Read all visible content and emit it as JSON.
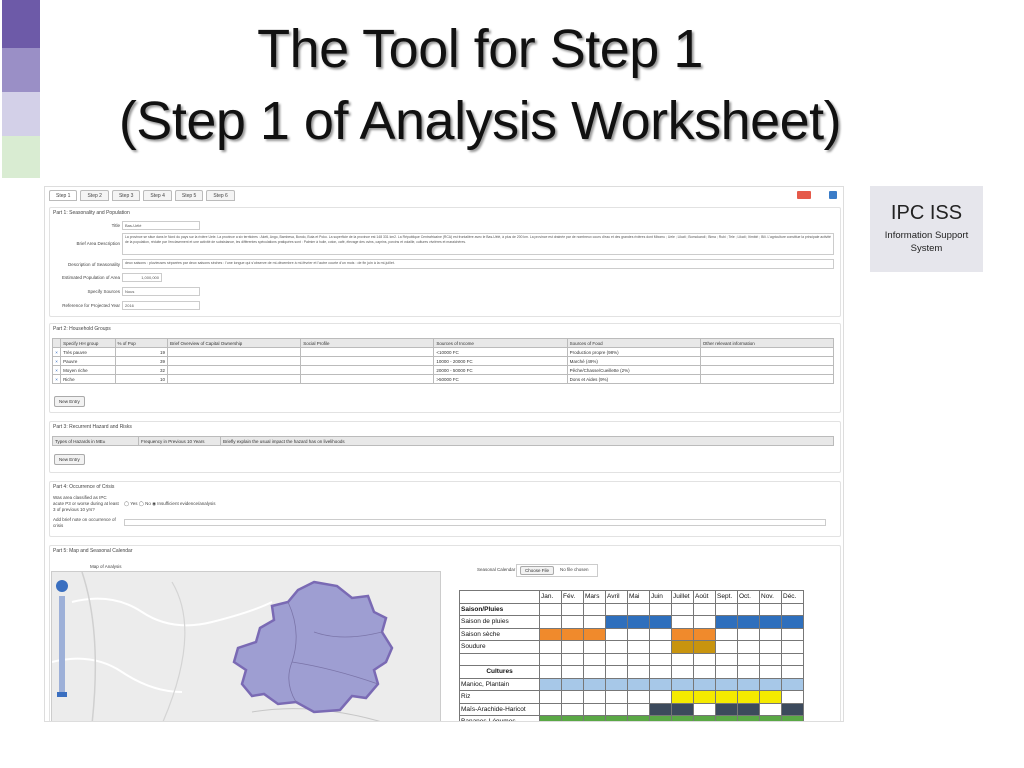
{
  "title_line1": "The Tool for Step 1",
  "title_line2": "(Step 1 of Analysis Worksheet)",
  "ipc": {
    "title": "IPC ISS",
    "line1": "Information Support",
    "line2": "System"
  },
  "tabs": [
    "Step 1",
    "Step 2",
    "Step 3",
    "Step 4",
    "Step 5",
    "Step 6"
  ],
  "part1": {
    "label": "Part 1: Seasonality and Population",
    "title_label": "Title",
    "title_value": "Bas-Uélé",
    "brief_label": "Brief Area Description",
    "brief_value": "La province se situe dans le Nord du pays sur la rivière Uele. La province a six territoires : Aketi, Ango, Bambesa, Bondo, Buta et Poko. La superficie de la province est 148 331 km2. La République Centrafricaine (RCA) est frontalière avec le Bas-Uélé, à plus de 200 km. La province est drainée par de nombreux cours d'eau et des grandes rivières dont Mbomu ; Uele ; Likati ; Bomokandi ; Bima ; Rubi ; Tele ; Likati ; Itimbiri ; Bili. L'agriculture constitue la principale activité de la population, réduite par l'enclavement et une activité de subsistance, les différentes spéculations pratiquées sont : Palmier à huile, coton, café, élevage des ovins, caprins, porcins et volaille, cultures vivrières et maraichères.",
    "season_label": "Description of Seasonality",
    "season_value": "deux saisons : pluvieuses séparées par deux saisons sèches : l'une longue qui s'observe de mi-décembre à mi-février et l'autre courte d'un mois : de fin juin à la mi-juillet.",
    "pop_label": "Estimated Population of Area",
    "pop_value": "1,000,000",
    "sources_label": "Specify Sources",
    "sources_value": "Nous",
    "ref_label": "Reference for Projected Year",
    "ref_value": "2016"
  },
  "part2": {
    "label": "Part 2: Household Groups",
    "headers": [
      "Specify HH group",
      "% of Pop",
      "Brief Overview of Capital Ownership",
      "Social Profile",
      "Sources of Income",
      "Sources of Food",
      "Other relevant information"
    ],
    "rows": [
      {
        "mark": "×",
        "group": "Très pauvre",
        "pct": "19",
        "income": "<10000 FC",
        "food": "Production propre (98%)"
      },
      {
        "mark": "×",
        "group": "Pauvre",
        "pct": "39",
        "income": "10000 - 20000 FC",
        "food": "Marché (49%)"
      },
      {
        "mark": "×",
        "group": "Moyen riche",
        "pct": "32",
        "income": "20000 - 50000 FC",
        "food": "Pêche/Chasse/Cueillette (2%)"
      },
      {
        "mark": "×",
        "group": "Riche",
        "pct": "10",
        "income": ">50000 FC",
        "food": "Dons et Aides (9%)"
      }
    ],
    "new_entry": "New Entry"
  },
  "part3": {
    "label": "Part 3: Recurrent Hazard and Risks",
    "headers": [
      "Types of Hazards in ΜΕ±",
      "Frequency in Previous 10 Years",
      "Briefly explain the usual impact the hazard has on livelihoods"
    ],
    "new_entry": "New Entry"
  },
  "part4": {
    "label": "Part 4: Occurrence of Crisis",
    "q1_l1": "Was area classified as IPC",
    "q1_l2": "acute P3 or worse during at least",
    "q1_l3": "3 of previous 10 yrs?",
    "options": "◯ Yes   ◯ No   ◉ Insufficient evidence/analysis",
    "q2_l1": "Add brief note on occurrence of",
    "q2_l2": "crisis"
  },
  "part5": {
    "label": "Part 5: Map and Seasonal Calendar",
    "map_label": "Map of Analysis",
    "cal_label": "Seasonal Calendar",
    "choose_file": "Choose File",
    "no_file": "No file chosen"
  },
  "calendar": {
    "months": [
      "Jan.",
      "Fév.",
      "Mars",
      "Avril",
      "Mai",
      "Juin",
      "Juillet",
      "Août",
      "Sept.",
      "Oct.",
      "Nov.",
      "Déc."
    ],
    "rows": [
      {
        "label": "Saison/Pluies",
        "bold": true,
        "cells": [
          "",
          "",
          "",
          "",
          "",
          "",
          "",
          "",
          "",
          "",
          "",
          ""
        ]
      },
      {
        "label": "Saison de pluies",
        "cells": [
          "",
          "",
          "",
          "#2e6fbd",
          "#2e6fbd",
          "#2e6fbd",
          "",
          "",
          "#2e6fbd",
          "#2e6fbd",
          "#2e6fbd",
          "#2e6fbd"
        ]
      },
      {
        "label": "Saison sèche",
        "cells": [
          "#f08a2c",
          "#f08a2c",
          "#f08a2c",
          "",
          "",
          "",
          "#f08a2c",
          "#f08a2c",
          "",
          "",
          "",
          ""
        ]
      },
      {
        "label": "Soudure",
        "cells": [
          "",
          "",
          "",
          "",
          "",
          "",
          "#c8940e",
          "#c8940e",
          "",
          "",
          "",
          ""
        ]
      },
      {
        "label": "",
        "cells": [
          "",
          "",
          "",
          "",
          "",
          "",
          "",
          "",
          "",
          "",
          "",
          ""
        ]
      },
      {
        "label": "Cultures",
        "bold": true,
        "center": true,
        "cells": [
          "",
          "",
          "",
          "",
          "",
          "",
          "",
          "",
          "",
          "",
          "",
          ""
        ]
      },
      {
        "label": "Manioc, Plantain",
        "cells": [
          "#a7c8e8",
          "#a7c8e8",
          "#a7c8e8",
          "#a7c8e8",
          "#a7c8e8",
          "#a7c8e8",
          "#a7c8e8",
          "#a7c8e8",
          "#a7c8e8",
          "#a7c8e8",
          "#a7c8e8",
          "#a7c8e8"
        ]
      },
      {
        "label": "Riz",
        "cells": [
          "",
          "",
          "",
          "",
          "",
          "",
          "#f5ea00",
          "#f5ea00",
          "#f5ea00",
          "#f5ea00",
          "#f5ea00",
          ""
        ]
      },
      {
        "label": "Maïs-Arachide-Haricot",
        "cells": [
          "",
          "",
          "",
          "",
          "",
          "#3c4a5c",
          "#3c4a5c",
          "",
          "#3c4a5c",
          "#3c4a5c",
          "",
          "#3c4a5c"
        ]
      },
      {
        "label": "Bananes-Légumes",
        "cells": [
          "#5aa845",
          "#5aa845",
          "#5aa845",
          "#5aa845",
          "#5aa845",
          "#5aa845",
          "#5aa845",
          "#5aa845",
          "#5aa845",
          "#5aa845",
          "#5aa845",
          "#5aa845"
        ]
      }
    ]
  }
}
